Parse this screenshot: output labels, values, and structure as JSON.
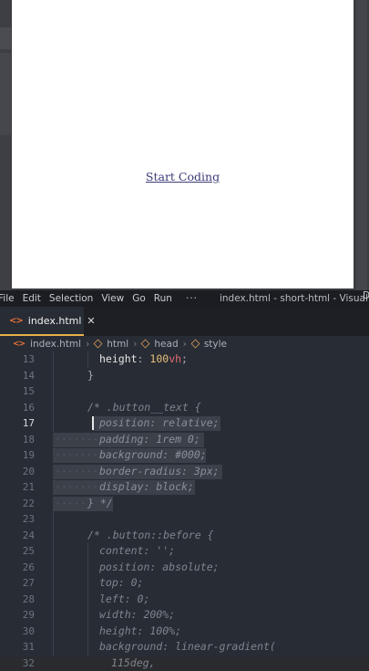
{
  "preview": {
    "link_text": "Start Coding"
  },
  "menubar": {
    "items": [
      "File",
      "Edit",
      "Selection",
      "View",
      "Go",
      "Run"
    ],
    "more": "···",
    "window_title": "index.html - short-html - Visual ...",
    "edge_char": "D"
  },
  "tab": {
    "icon": "<>",
    "label": "index.html",
    "close": "✕"
  },
  "breadcrumb": {
    "items": [
      "index.html",
      "html",
      "head",
      "style"
    ],
    "separator": "›"
  },
  "editor": {
    "active_line": 17,
    "lines": [
      {
        "n": "13",
        "text": "height: 100vh;"
      },
      {
        "n": "14",
        "text": "}"
      },
      {
        "n": "15",
        "text": ""
      },
      {
        "n": "16",
        "text": "/* .button__text {"
      },
      {
        "n": "17",
        "text": "position: relative;"
      },
      {
        "n": "18",
        "text": "padding: 1rem 0;"
      },
      {
        "n": "19",
        "text": "background: #000;"
      },
      {
        "n": "20",
        "text": "border-radius: 3px;"
      },
      {
        "n": "21",
        "text": "display: block;"
      },
      {
        "n": "22",
        "text": "} */"
      },
      {
        "n": "23",
        "text": ""
      },
      {
        "n": "24",
        "text": "/* .button::before {"
      },
      {
        "n": "25",
        "text": "content: '';"
      },
      {
        "n": "26",
        "text": "position: absolute;"
      },
      {
        "n": "27",
        "text": "top: 0;"
      },
      {
        "n": "28",
        "text": "left: 0;"
      },
      {
        "n": "29",
        "text": "width: 200%;"
      },
      {
        "n": "30",
        "text": "height: 100%;"
      },
      {
        "n": "31",
        "text": "background: linear-gradient("
      },
      {
        "n": "32",
        "text": "115deg,"
      }
    ]
  },
  "colors": {
    "accent_tab": "#e8b04b",
    "html_icon": "#e8733a",
    "number_value": "#e6c07b",
    "unit": "#e06c75"
  }
}
